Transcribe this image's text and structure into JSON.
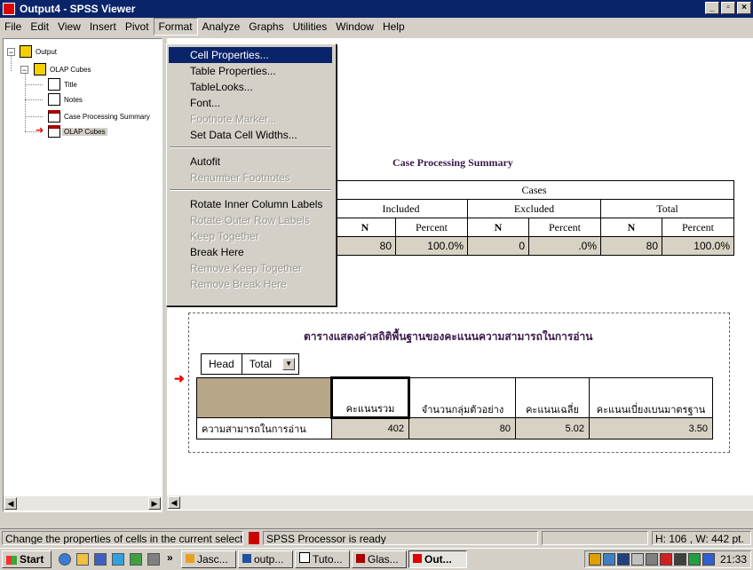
{
  "window": {
    "title": "Output4 - SPSS Viewer",
    "buttons": {
      "minimize": "_",
      "restore": "▫",
      "close": "×"
    }
  },
  "menubar": [
    {
      "label": "File"
    },
    {
      "label": "Edit"
    },
    {
      "label": "View"
    },
    {
      "label": "Insert"
    },
    {
      "label": "Pivot"
    },
    {
      "label": "Format"
    },
    {
      "label": "Analyze"
    },
    {
      "label": "Graphs"
    },
    {
      "label": "Utilities"
    },
    {
      "label": "Window"
    },
    {
      "label": "Help"
    }
  ],
  "format_menu": {
    "items": [
      {
        "label": "Cell Properties...",
        "state": "highlighted"
      },
      {
        "label": "Table Properties...",
        "state": "enabled"
      },
      {
        "label": "TableLooks...",
        "state": "enabled"
      },
      {
        "label": "Font...",
        "state": "enabled"
      },
      {
        "label": "Footnote Marker...",
        "state": "disabled"
      },
      {
        "label": "Set Data Cell Widths...",
        "state": "enabled"
      },
      {
        "label": "Autofit",
        "state": "enabled"
      },
      {
        "label": "Renumber Footnotes",
        "state": "disabled"
      },
      {
        "label": "Rotate Inner Column Labels",
        "state": "enabled"
      },
      {
        "label": "Rotate Outer Row Labels",
        "state": "disabled"
      },
      {
        "label": "Keep Together",
        "state": "disabled"
      },
      {
        "label": "Break Here",
        "state": "enabled"
      },
      {
        "label": "Remove Keep Together",
        "state": "disabled"
      },
      {
        "label": "Remove Break Here",
        "state": "disabled"
      }
    ]
  },
  "outline": {
    "root": "Output",
    "group": "OLAP Cubes",
    "children": [
      "Title",
      "Notes",
      "Case Processing Summary",
      "OLAP Cubes"
    ],
    "selected": "OLAP Cubes"
  },
  "case_processing": {
    "title": "Case Processing Summary",
    "cases_header": "Cases",
    "groups": [
      "Included",
      "Excluded",
      "Total"
    ],
    "sub_headers": [
      "N",
      "Percent",
      "N",
      "Percent",
      "N",
      "Percent"
    ],
    "row": [
      "80",
      "100.0%",
      "0",
      ".0%",
      "80",
      "100.0%"
    ]
  },
  "olap": {
    "title": "ตารางแสดงค่าสถิติพื้นฐานของคะแนนความสามารถในการอ่าน",
    "layer_label": "Head",
    "layer_value": "Total",
    "columns": [
      "คะแนนรวม",
      "จำนวนกลุ่มตัวอย่าง",
      "คะแนนเฉลี่ย",
      "คะแนนเบี่ยงเบนมาตรฐาน"
    ],
    "row_label": "ความสามารถในการอ่าน",
    "values": [
      "402",
      "80",
      "5.02",
      "3.50"
    ]
  },
  "statusbar": {
    "message": "Change the properties of cells in the current selection",
    "processor": "SPSS Processor  is ready",
    "dimensions": "H: 106 , W: 442  pt."
  },
  "taskbar": {
    "start_label": "Start",
    "chevron": "»",
    "buttons": [
      {
        "label": "Jasc..."
      },
      {
        "label": "outp..."
      },
      {
        "label": "Tuto..."
      },
      {
        "label": "Glas..."
      },
      {
        "label": "Out...",
        "active": true
      }
    ],
    "clock": "21:33"
  }
}
